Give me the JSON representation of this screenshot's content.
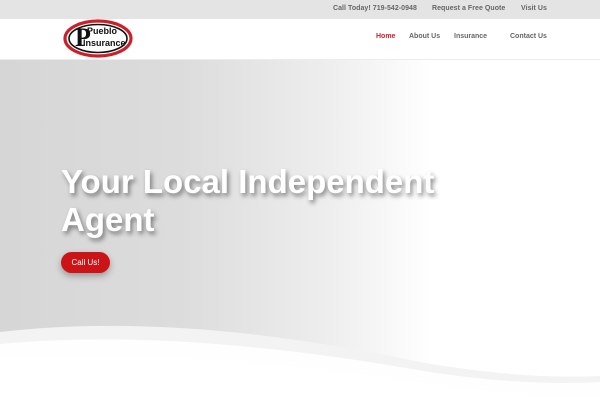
{
  "topbar": {
    "phone": "Call Today! 719-542-0948",
    "quote": "Request a Free Quote",
    "visit": "Visit Us"
  },
  "header": {
    "logo": {
      "line1": "Pueblo",
      "line2": "Insurance"
    },
    "nav": {
      "home": "Home",
      "about": "About Us",
      "insurance": "Insurance",
      "contact": "Contact Us"
    }
  },
  "hero": {
    "title": "Your Local Independent Agent",
    "cta": "Call Us!"
  },
  "colors": {
    "accent": "#cc1f2a",
    "button": "#cc1417",
    "topbar": "#e4e4e4",
    "nav_text": "#666666"
  }
}
